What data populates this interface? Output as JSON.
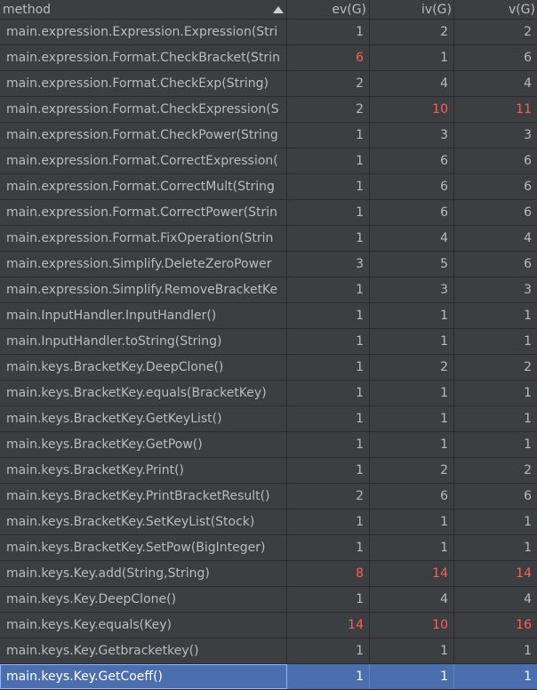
{
  "header": {
    "method": "method",
    "ev": "ev(G)",
    "iv": "iv(G)",
    "v": "v(G)"
  },
  "colors": {
    "background": "#3c3f41",
    "text": "#bbbbbb",
    "highlight_red": "#ff5f56",
    "selected_row": "#4b6eaf"
  },
  "rows": [
    {
      "method": "main.expression.Expression.Expression(Stri",
      "ev": "1",
      "iv": "2",
      "v": "2",
      "red": []
    },
    {
      "method": "main.expression.Format.CheckBracket(Strin",
      "ev": "6",
      "iv": "1",
      "v": "6",
      "red": [
        "ev"
      ]
    },
    {
      "method": "main.expression.Format.CheckExp(String)",
      "ev": "2",
      "iv": "4",
      "v": "4",
      "red": []
    },
    {
      "method": "main.expression.Format.CheckExpression(S",
      "ev": "2",
      "iv": "10",
      "v": "11",
      "red": [
        "iv",
        "v"
      ]
    },
    {
      "method": "main.expression.Format.CheckPower(String",
      "ev": "1",
      "iv": "3",
      "v": "3",
      "red": []
    },
    {
      "method": "main.expression.Format.CorrectExpression(",
      "ev": "1",
      "iv": "6",
      "v": "6",
      "red": []
    },
    {
      "method": "main.expression.Format.CorrectMult(String",
      "ev": "1",
      "iv": "6",
      "v": "6",
      "red": []
    },
    {
      "method": "main.expression.Format.CorrectPower(Strin",
      "ev": "1",
      "iv": "6",
      "v": "6",
      "red": []
    },
    {
      "method": "main.expression.Format.FixOperation(Strin",
      "ev": "1",
      "iv": "4",
      "v": "4",
      "red": []
    },
    {
      "method": "main.expression.Simplify.DeleteZeroPower",
      "ev": "3",
      "iv": "5",
      "v": "6",
      "red": []
    },
    {
      "method": "main.expression.Simplify.RemoveBracketKe",
      "ev": "1",
      "iv": "3",
      "v": "3",
      "red": []
    },
    {
      "method": "main.InputHandler.InputHandler()",
      "ev": "1",
      "iv": "1",
      "v": "1",
      "red": []
    },
    {
      "method": "main.InputHandler.toString(String)",
      "ev": "1",
      "iv": "1",
      "v": "1",
      "red": []
    },
    {
      "method": "main.keys.BracketKey.DeepClone()",
      "ev": "1",
      "iv": "2",
      "v": "2",
      "red": []
    },
    {
      "method": "main.keys.BracketKey.equals(BracketKey)",
      "ev": "1",
      "iv": "1",
      "v": "1",
      "red": []
    },
    {
      "method": "main.keys.BracketKey.GetKeyList()",
      "ev": "1",
      "iv": "1",
      "v": "1",
      "red": []
    },
    {
      "method": "main.keys.BracketKey.GetPow()",
      "ev": "1",
      "iv": "1",
      "v": "1",
      "red": []
    },
    {
      "method": "main.keys.BracketKey.Print()",
      "ev": "1",
      "iv": "2",
      "v": "2",
      "red": []
    },
    {
      "method": "main.keys.BracketKey.PrintBracketResult()",
      "ev": "2",
      "iv": "6",
      "v": "6",
      "red": []
    },
    {
      "method": "main.keys.BracketKey.SetKeyList(Stock)",
      "ev": "1",
      "iv": "1",
      "v": "1",
      "red": []
    },
    {
      "method": "main.keys.BracketKey.SetPow(BigInteger)",
      "ev": "1",
      "iv": "1",
      "v": "1",
      "red": []
    },
    {
      "method": "main.keys.Key.add(String,String)",
      "ev": "8",
      "iv": "14",
      "v": "14",
      "red": [
        "ev",
        "iv",
        "v"
      ]
    },
    {
      "method": "main.keys.Key.DeepClone()",
      "ev": "1",
      "iv": "4",
      "v": "4",
      "red": []
    },
    {
      "method": "main.keys.Key.equals(Key)",
      "ev": "14",
      "iv": "10",
      "v": "16",
      "red": [
        "ev",
        "iv",
        "v"
      ]
    },
    {
      "method": "main.keys.Key.Getbracketkey()",
      "ev": "1",
      "iv": "1",
      "v": "1",
      "red": []
    },
    {
      "method": "main.keys.Key.GetCoeff()",
      "ev": "1",
      "iv": "1",
      "v": "1",
      "red": [],
      "selected": true
    }
  ]
}
